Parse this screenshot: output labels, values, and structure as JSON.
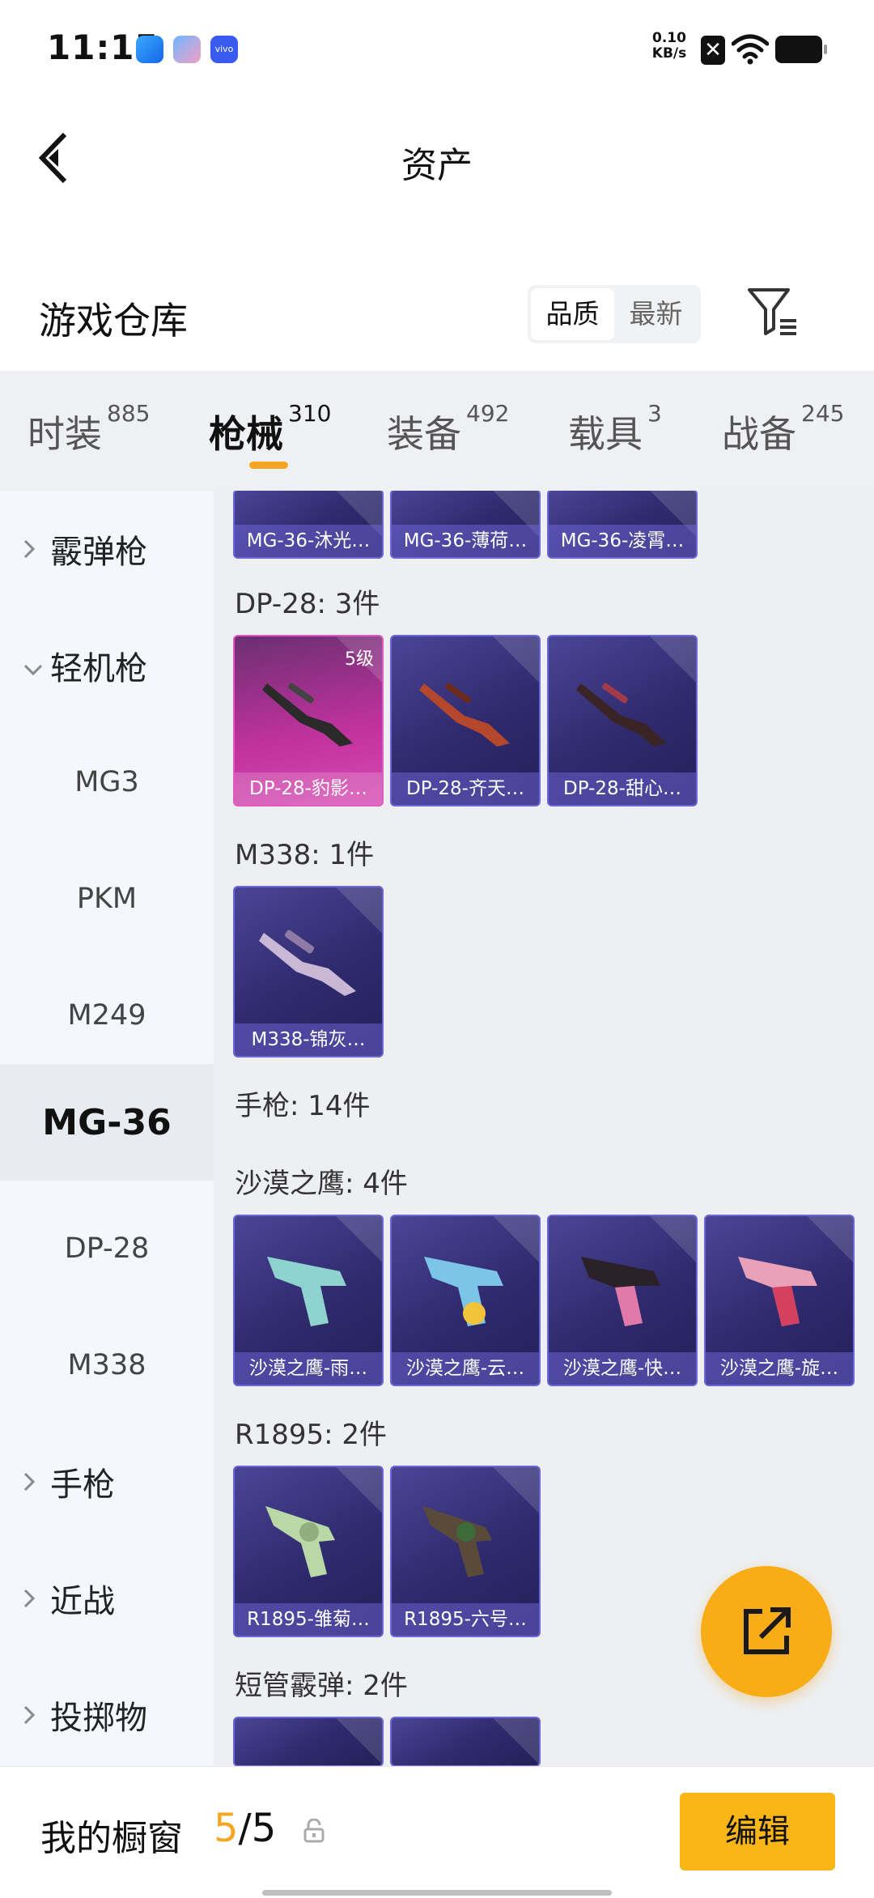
{
  "status_bar": {
    "time": "11:15",
    "net_speed_value": "0.10",
    "net_speed_unit": "KB/s",
    "icons": [
      "browser-icon",
      "app-store-icon",
      "vivo-icon",
      "close-x-icon",
      "wifi-icon",
      "battery-icon"
    ]
  },
  "nav": {
    "title": "资产",
    "back_icon": "chevron-left-icon"
  },
  "warehouse": {
    "title": "游戏仓库",
    "sort_options": [
      "品质",
      "最新"
    ],
    "active_sort": "品质",
    "filter_icon": "filter-icon"
  },
  "tabs": [
    {
      "label": "时装",
      "count": "885"
    },
    {
      "label": "枪械",
      "count": "310",
      "active": true
    },
    {
      "label": "装备",
      "count": "492"
    },
    {
      "label": "载具",
      "count": "3"
    },
    {
      "label": "战备",
      "count": "245"
    }
  ],
  "sidebar": {
    "items": [
      {
        "label": "霰弹枪",
        "type": "parent",
        "expanded": false
      },
      {
        "label": "轻机枪",
        "type": "parent",
        "expanded": true
      },
      {
        "label": "MG3",
        "type": "child"
      },
      {
        "label": "PKM",
        "type": "child"
      },
      {
        "label": "M249",
        "type": "child"
      },
      {
        "label": "MG-36",
        "type": "child",
        "selected": true
      },
      {
        "label": "DP-28",
        "type": "child"
      },
      {
        "label": "M338",
        "type": "child"
      },
      {
        "label": "手枪",
        "type": "parent",
        "expanded": false
      },
      {
        "label": "近战",
        "type": "parent",
        "expanded": false
      },
      {
        "label": "投掷物",
        "type": "parent",
        "expanded": false
      }
    ]
  },
  "content": {
    "mg36_items": [
      "MG-36-沐光…",
      "MG-36-薄荷…",
      "MG-36-凌霄…"
    ],
    "dp28": {
      "label": "DP-28: 3件",
      "items": [
        "DP-28-豹影…",
        "DP-28-齐天…",
        "DP-28-甜心…"
      ],
      "first_level": "5级"
    },
    "m338": {
      "label": "M338: 1件",
      "items": [
        "M338-锦灰…"
      ]
    },
    "pistol_label": "手枪: 14件",
    "deagle": {
      "label": "沙漠之鹰: 4件",
      "items": [
        "沙漠之鹰-雨…",
        "沙漠之鹰-云…",
        "沙漠之鹰-快…",
        "沙漠之鹰-旋…"
      ]
    },
    "r1895": {
      "label": "R1895: 2件",
      "items": [
        "R1895-雏菊…",
        "R1895-六号…"
      ]
    },
    "sawed_off": {
      "label": "短管霰弹: 2件"
    }
  },
  "fab": {
    "icon": "share-out-icon"
  },
  "bottom_bar": {
    "label": "我的橱窗",
    "current": "5",
    "separator": "/",
    "total": "5",
    "lock_icon": "unlock-icon",
    "edit_label": "编辑"
  },
  "colors": {
    "accent": "#f5a623",
    "card": "#2f2a6d",
    "card_rare": "#c3329f"
  }
}
